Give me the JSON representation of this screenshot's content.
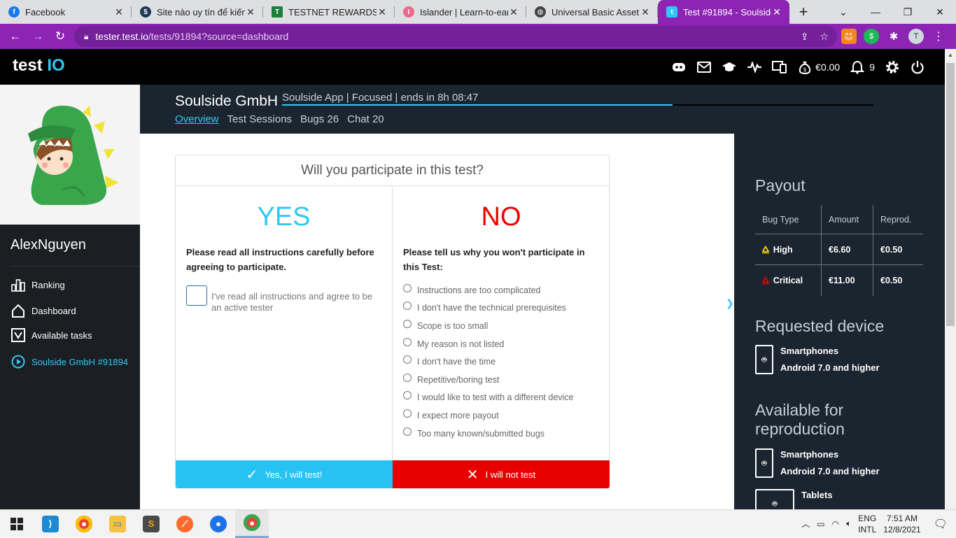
{
  "browser": {
    "tabs": [
      {
        "title": "Facebook",
        "favicon_color": "#1877f2",
        "favicon": "f",
        "active": false
      },
      {
        "title": "Site nào uy tín để kiếm",
        "favicon_color": "#1d3b57",
        "favicon": "$",
        "active": false
      },
      {
        "title": "TESTNET REWARDS.xl",
        "favicon_color": "#188038",
        "favicon": "T",
        "active": false
      },
      {
        "title": "Islander | Learn-to-ear",
        "favicon_color": "#e96b8c",
        "favicon": "I",
        "active": false
      },
      {
        "title": "Universal Basic Asset",
        "favicon_color": "#444444",
        "favicon": "U",
        "active": false
      },
      {
        "title": "Test #91894 - Soulside",
        "favicon_color": "#30c8f5",
        "favicon": "t",
        "active": true
      }
    ],
    "new_tab": "+",
    "url_host": "tester.test.io",
    "url_path": "/tests/91894?source=dashboard",
    "profile_initial": "T",
    "accent": "#8c24b4"
  },
  "app": {
    "logo_main": "test",
    "logo_io": "IO",
    "balance": "€0.00",
    "notifications": "9",
    "accent": "#30c8f5"
  },
  "sidebar": {
    "username": "AlexNguyen",
    "items": [
      {
        "label": "Ranking",
        "icon": "ranking-icon"
      },
      {
        "label": "Dashboard",
        "icon": "home-icon"
      },
      {
        "label": "Available tasks",
        "icon": "tasks-icon"
      },
      {
        "label": "Soulside GmbH #91894",
        "icon": "play-circle-icon",
        "current": true
      }
    ]
  },
  "project": {
    "company": "Soulside GmbH",
    "test_info": "Soulside App | Focused | ends in 8h 08:47",
    "progress_fraction": 0.66,
    "tabs": [
      {
        "label": "Overview",
        "active": true
      },
      {
        "label": "Test Sessions"
      },
      {
        "label": "Bugs 26"
      },
      {
        "label": "Chat 20"
      }
    ]
  },
  "participation": {
    "question": "Will you participate in this test?",
    "yes": {
      "title": "YES",
      "instruction": "Please read all instructions carefully before agreeing to participate.",
      "checkbox_label": "I've read all instructions and agree to be an active tester",
      "button": "Yes, I will test!"
    },
    "no": {
      "title": "NO",
      "instruction": "Please tell us why you won't participate in this Test:",
      "reasons": [
        "Instructions are too complicated",
        "I don't have the technical prerequisites",
        "Scope is too small",
        "My reason is not listed",
        "I don't have the time",
        "Repetitive/boring test",
        "I would like to test with a different device",
        "I expect more payout",
        "Too many known/submitted bugs"
      ],
      "button": "I will not test"
    }
  },
  "payout": {
    "title": "Payout",
    "headers": [
      "Bug Type",
      "Amount",
      "Reprod."
    ],
    "rows": [
      {
        "type": "High",
        "amount": "€6.60",
        "reprod": "€0.50",
        "color": "#f5d000"
      },
      {
        "type": "Critical",
        "amount": "€11.00",
        "reprod": "€0.50",
        "color": "#e60000"
      }
    ]
  },
  "requested_device": {
    "title": "Requested device",
    "category": "Smartphones",
    "os": "Android 7.0 and higher"
  },
  "reproduction": {
    "title": "Available for reproduction",
    "devices": [
      {
        "category": "Smartphones",
        "os": "Android 7.0 and higher"
      },
      {
        "category": "Tablets",
        "os": ""
      }
    ]
  },
  "taskbar": {
    "apps": [
      {
        "name": "start-button",
        "color": "#0078d4"
      },
      {
        "name": "vscode",
        "color": "#1f8ad2"
      },
      {
        "name": "chrome",
        "color": "#e94235"
      },
      {
        "name": "file-explorer",
        "color": "#f5c242"
      },
      {
        "name": "sublime-text",
        "color": "#f0a020"
      },
      {
        "name": "compass",
        "color": "#ff6a2c"
      },
      {
        "name": "maps",
        "color": "#1a73e8"
      },
      {
        "name": "chrome-profile",
        "color": "#e94235"
      }
    ],
    "lang1": "ENG",
    "lang2": "INTL",
    "time": "7:51 AM",
    "date": "12/8/2021"
  }
}
